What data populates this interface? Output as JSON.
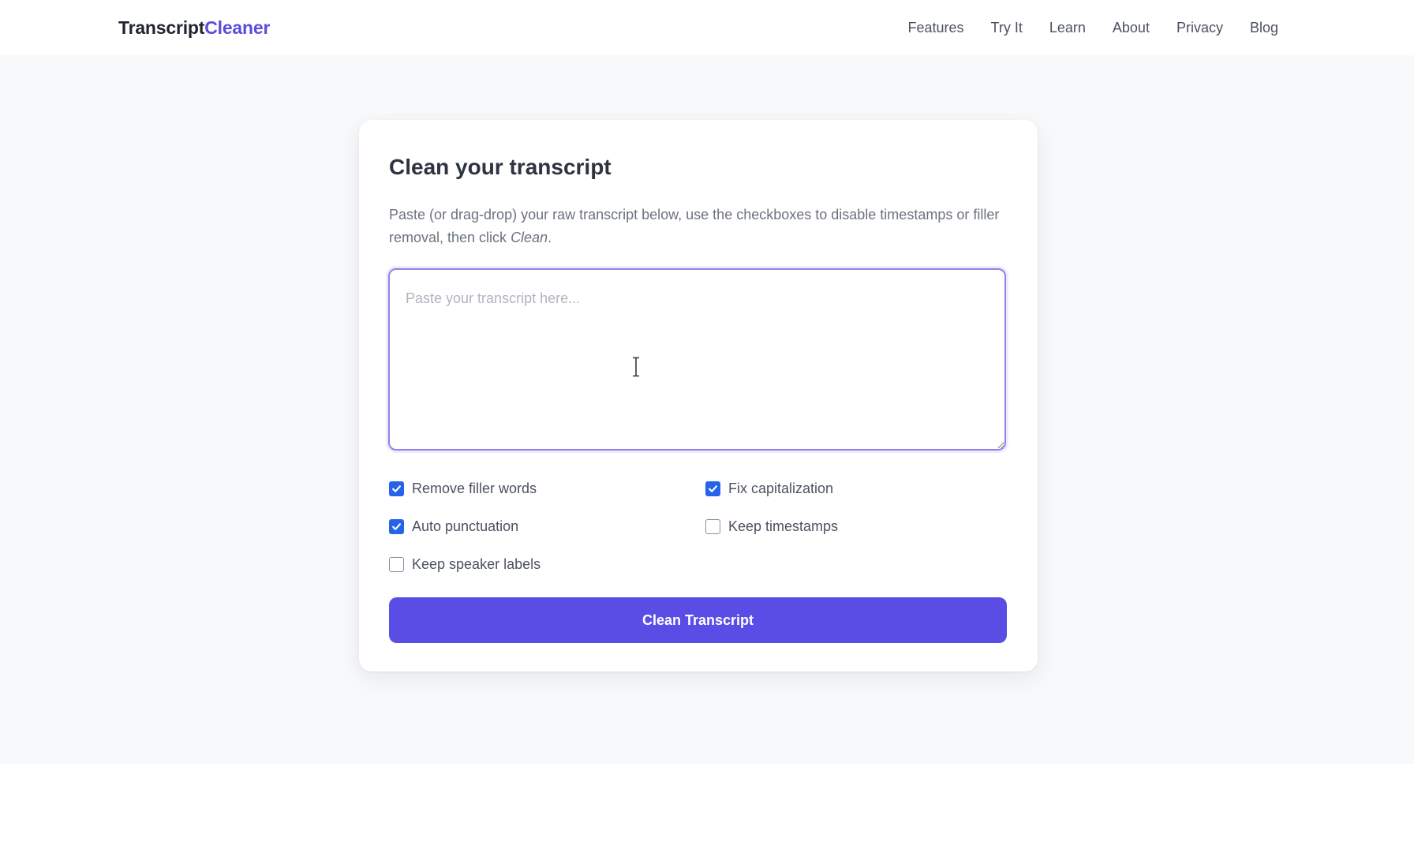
{
  "header": {
    "logo_primary": "Transcript",
    "logo_accent": "Cleaner",
    "nav": [
      {
        "label": "Features"
      },
      {
        "label": "Try It"
      },
      {
        "label": "Learn"
      },
      {
        "label": "About"
      },
      {
        "label": "Privacy"
      },
      {
        "label": "Blog"
      }
    ]
  },
  "card": {
    "title": "Clean your transcript",
    "description_part1": "Paste (or drag-drop) your raw transcript below, use the checkboxes to disable timestamps or filler removal, then click ",
    "description_emphasis": "Clean",
    "description_part2": ".",
    "textarea": {
      "placeholder": "Paste your transcript here...",
      "value": ""
    },
    "options": [
      {
        "label": "Remove filler words",
        "checked": true
      },
      {
        "label": "Fix capitalization",
        "checked": true
      },
      {
        "label": "Auto punctuation",
        "checked": true
      },
      {
        "label": "Keep timestamps",
        "checked": false
      },
      {
        "label": "Keep speaker labels",
        "checked": false
      }
    ],
    "button_label": "Clean Transcript"
  },
  "colors": {
    "brand": "#5b4cdb",
    "button": "#5a4de6",
    "checkbox_checked": "#2563eb",
    "page_bg": "#f8f9fb"
  },
  "icons": {
    "checked": "check-icon",
    "cursor": "text-cursor-icon"
  }
}
